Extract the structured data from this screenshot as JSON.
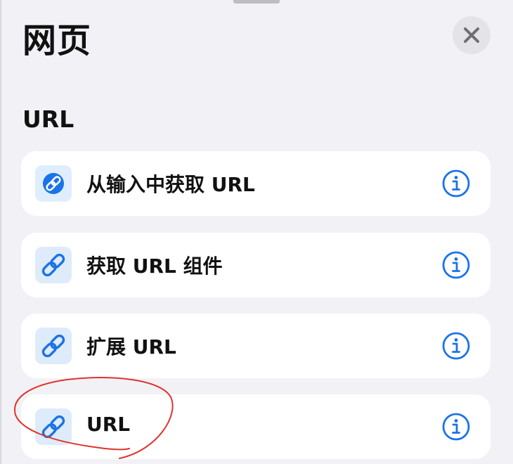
{
  "header": {
    "title": "网页"
  },
  "section": {
    "title": "URL"
  },
  "actions": [
    {
      "label": "从输入中获取 URL",
      "icon": "link-circle-icon"
    },
    {
      "label": "获取 URL 组件",
      "icon": "link-icon"
    },
    {
      "label": "扩展 URL",
      "icon": "link-icon"
    },
    {
      "label": "URL",
      "icon": "link-icon"
    }
  ],
  "colors": {
    "accent": "#1a73e8",
    "background": "#f2f2f6",
    "card": "#ffffff",
    "annotation": "#e0332c"
  }
}
